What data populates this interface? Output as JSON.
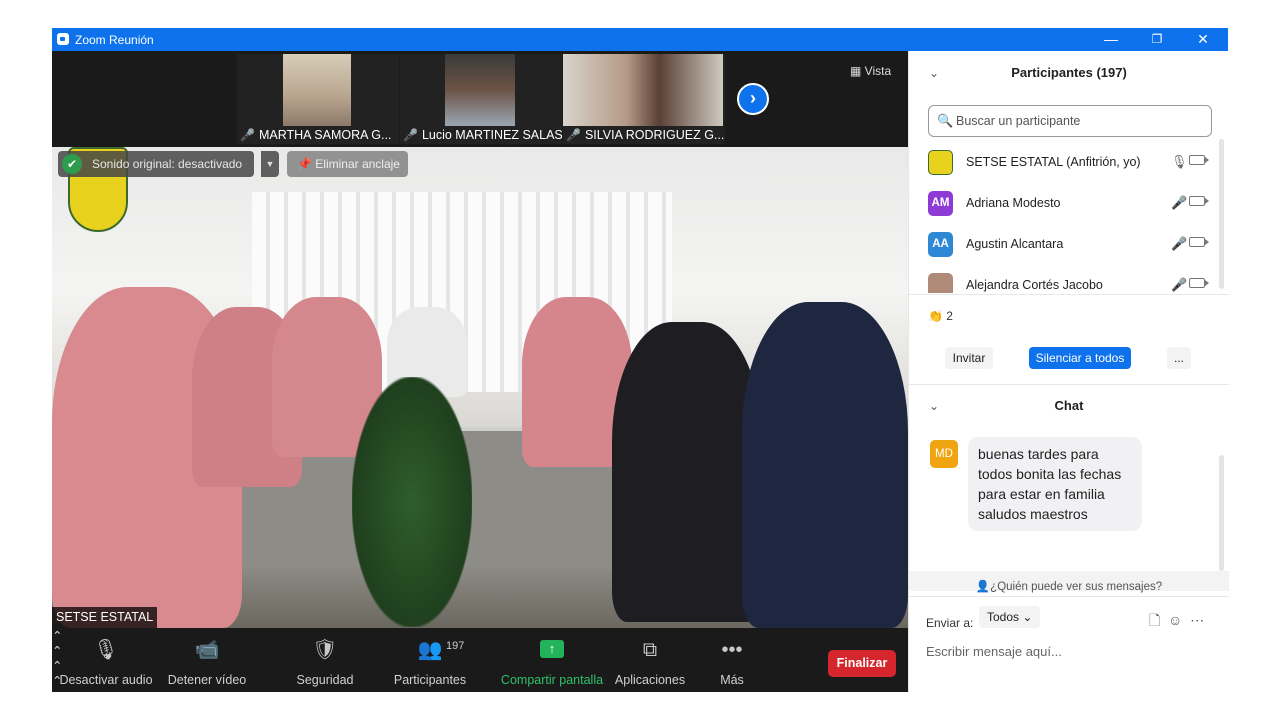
{
  "window": {
    "title": "Zoom Reunión",
    "controls": [
      "—",
      "❐",
      "✕"
    ]
  },
  "gallery": {
    "thumbnails": [
      {
        "name": "MARTHA SAMORA G..."
      },
      {
        "name": "Lucio MARTINEZ SALAS"
      },
      {
        "name": "SILVIA RODRIGUEZ G..."
      }
    ],
    "next_icon": "›",
    "view_label": "Vista"
  },
  "main_video": {
    "original_sound_label": "Sonido original: desactivado",
    "unpin_label": "Eliminar anclaje",
    "speaker_name": "SETSE ESTATAL"
  },
  "toolbar": {
    "mute_label": "Desactivar audio",
    "video_label": "Detener vídeo",
    "security_label": "Seguridad",
    "participants_label": "Participantes",
    "participants_count": "197",
    "share_label": "Compartir pantalla",
    "apps_label": "Aplicaciones",
    "more_label": "Más",
    "end_label": "Finalizar"
  },
  "participants_panel": {
    "title": "Participantes (197)",
    "search_placeholder": "Buscar un participante",
    "items": [
      {
        "initials": "",
        "name": "SETSE ESTATAL (Anfitrión, yo)",
        "muted": false,
        "avatar_color": "#e8d21e"
      },
      {
        "initials": "AM",
        "name": "Adriana Modesto",
        "muted": true,
        "avatar_color": "#8e3bd6"
      },
      {
        "initials": "AA",
        "name": "Agustin Alcantara",
        "muted": true,
        "avatar_color": "#2f88d6"
      },
      {
        "initials": "",
        "name": "Alejandra Cortés Jacobo",
        "muted": true,
        "avatar_color": "#b08a78"
      }
    ],
    "reaction_icon": "👏",
    "reaction_count": "2",
    "invite_label": "Invitar",
    "mute_all_label": "Silenciar a todos",
    "more_label": "..."
  },
  "chat": {
    "title": "Chat",
    "messages": [
      {
        "initials": "MD",
        "text": "buenas tardes para todos bonita las fechas para estar en familia saludos maestros"
      }
    ],
    "who_can_see": "¿Quién puede ver sus mensajes?",
    "send_to_label": "Enviar a:",
    "send_to_value": "Todos",
    "input_placeholder": "Escribir mensaje aquí..."
  }
}
